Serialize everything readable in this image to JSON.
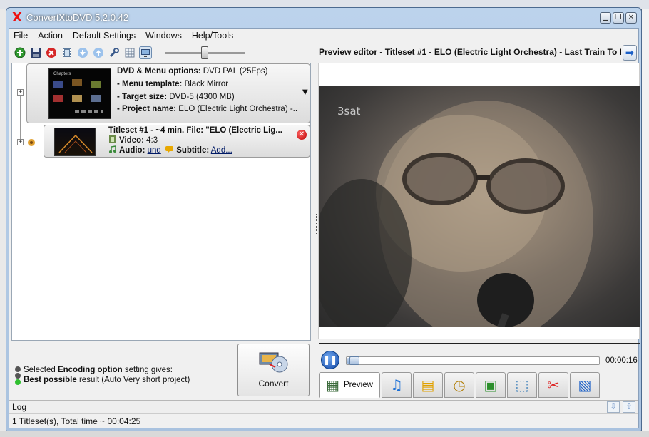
{
  "window": {
    "title": "ConvertXtoDVD 5.2.0.42",
    "app_icon_glyph": "X",
    "controls": {
      "minimize": "▁",
      "restore": "❐",
      "close": "✕"
    }
  },
  "menu": [
    "File",
    "Action",
    "Default Settings",
    "Windows",
    "Help/Tools"
  ],
  "toolbar": {
    "icons": [
      "add-icon",
      "save-icon",
      "delete-icon",
      "film-icon",
      "move-down-icon",
      "move-up-icon",
      "tools-icon",
      "grid-icon",
      "monitor-icon"
    ],
    "zoom_level": 0.5
  },
  "project": {
    "expander": "+",
    "options_label": "DVD & Menu options:",
    "options_value": "DVD PAL (25Fps)",
    "template_label": "- Menu template:",
    "template_value": "Black Mirror",
    "target_label": "- Target size:",
    "target_value": "DVD-5 (4300 MB)",
    "name_label": "- Project name:",
    "name_value": "ELO (Electric Light Orchestra) -...",
    "thumb_caption": "Chapters"
  },
  "titleset": {
    "expander": "+",
    "title": "Titleset #1 - ~4 min. File: \"ELO (Electric Lig...",
    "video_label": "Video:",
    "video_value": "4:3",
    "audio_label": "Audio:",
    "audio_value": "und",
    "subtitle_label": "Subtitle:",
    "subtitle_value": "Add...",
    "remove_glyph": "✕"
  },
  "encoding": {
    "line1_prefix": "Selected ",
    "line1_bold": "Encoding option",
    "line1_suffix": " setting gives:",
    "line2_bold": "Best possible",
    "line2_suffix": " result (Auto Very short project)"
  },
  "convert": {
    "label": "Convert"
  },
  "preview": {
    "title": "Preview editor - Titleset #1 - ELO (Electric Light Orchestra) - Last Train To L",
    "nav_glyph": "➡",
    "watermark": "3sat",
    "time": "00:00:16",
    "pause_glyph": "❚❚",
    "progress": 0.02
  },
  "tabs": [
    {
      "name": "tab-preview",
      "icon": "▦",
      "label": "Preview",
      "active": true
    },
    {
      "name": "tab-audio",
      "icon": "♫",
      "color": "#1a6fd6"
    },
    {
      "name": "tab-subtitles",
      "icon": "▤",
      "color": "#e0a100"
    },
    {
      "name": "tab-chapters",
      "icon": "◷",
      "color": "#b07b00"
    },
    {
      "name": "tab-image",
      "icon": "▣",
      "color": "#2b8f2b"
    },
    {
      "name": "tab-crop",
      "icon": "⬚",
      "color": "#1c6bb0"
    },
    {
      "name": "tab-cut",
      "icon": "✂",
      "color": "#d22"
    },
    {
      "name": "tab-effects",
      "icon": "▧",
      "color": "#1a5fc7"
    }
  ],
  "log": {
    "label": "Log",
    "down_glyph": "⇩",
    "up_glyph": "⇧"
  },
  "status": {
    "text": "1 Titleset(s), Total time ~ 00:04:25"
  }
}
